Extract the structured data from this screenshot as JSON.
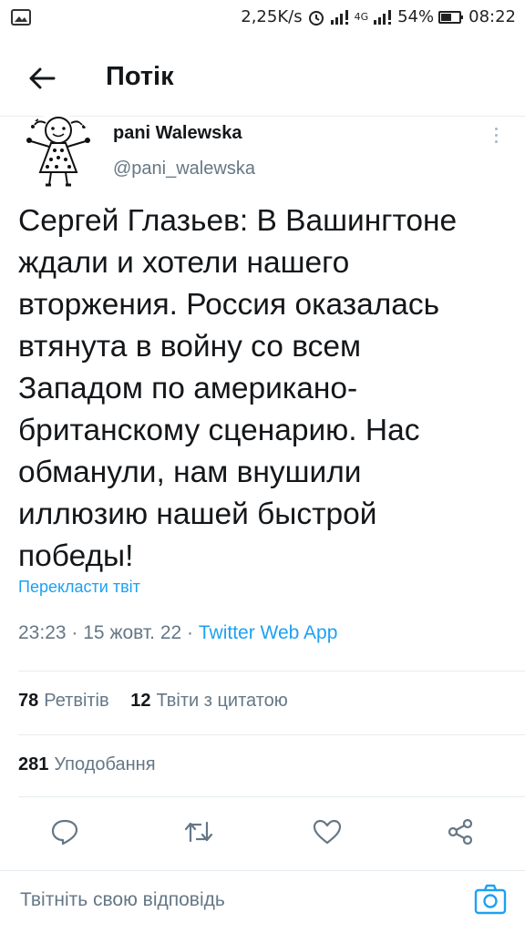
{
  "status_bar": {
    "speed": "2,25K/s",
    "network_label": "4G",
    "battery": "54%",
    "time": "08:22"
  },
  "header": {
    "title": "Потік"
  },
  "tweet": {
    "display_name": "pani Walewska",
    "handle": "@pani_walewska",
    "text": "Сергей Глазьев: В Вашингтоне\nждали и хотели нашего\nвторжения. Россия оказалась\nвтянута в войну со всем\nЗападом по американо-\nбританскому сценарию. Нас\nобманули, нам внушили\nиллюзию нашей быстрой\nпобеды!",
    "translate_label": "Перекласти твіт",
    "time": "23:23",
    "date": "15 жовт. 22",
    "source": "Twitter Web App",
    "separator": "·"
  },
  "stats": {
    "retweets_count": "78",
    "retweets_label": "Ретвітів",
    "quotes_count": "12",
    "quotes_label": "Твіти з цитатою",
    "likes_count": "281",
    "likes_label": "Уподобання"
  },
  "actions": {
    "icons": [
      "reply-icon",
      "retweet-icon",
      "like-icon",
      "share-icon"
    ]
  },
  "reply": {
    "placeholder": "Твітніть свою відповідь"
  },
  "colors": {
    "accent": "#1da1f2",
    "secondary_text": "#657786",
    "primary_text": "#14171a",
    "divider": "#e6ecf0"
  }
}
